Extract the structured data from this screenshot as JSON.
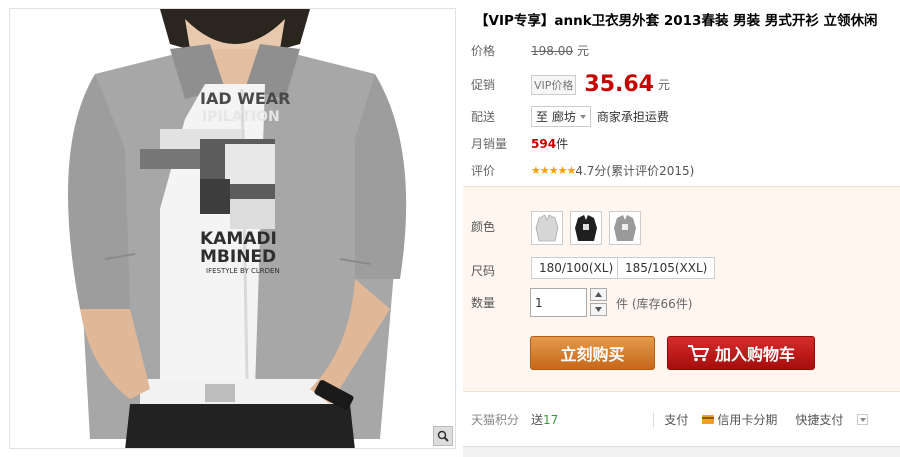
{
  "product": {
    "title": "【VIP专享】annk卫衣男外套 2013春装 男装 男式开衫 立领休闲",
    "print_lines": [
      "IAD WEAR",
      "IPILATION",
      "KAMADI",
      "MBINED",
      "IFESTYLE BY CLRDEN"
    ]
  },
  "price": {
    "label": "价格",
    "original": "198.00",
    "unit": "元"
  },
  "promo": {
    "label": "促销",
    "vip_tag": "VIP价格",
    "price": "35.64",
    "unit": "元"
  },
  "shipping": {
    "label": "配送",
    "destination": "至 廊坊",
    "note": "商家承担运费"
  },
  "sales": {
    "label": "月销量",
    "count": "594",
    "unit": "件"
  },
  "rating": {
    "label": "评价",
    "stars": "★★★★★",
    "text": "4.7分(累计评价2015)"
  },
  "options": {
    "color_label": "颜色",
    "size_label": "尺码",
    "sizes": [
      "180/100(XL)",
      "185/105(XXL)"
    ],
    "quantity_label": "数量",
    "quantity_value": "1",
    "stock_text": "件 (库存66件)"
  },
  "buttons": {
    "buy_now": "立刻购买",
    "add_to_cart": "加入购物车"
  },
  "bottom": {
    "points_label": "天猫积分",
    "points_value": "17",
    "points_prefix": "送",
    "pay_label": "支付",
    "credit_card": "信用卡分期",
    "quick_pay": "快捷支付"
  },
  "colors": {
    "price_red": "#c40000",
    "buy_orange": "#d27a2a",
    "cart_red": "#c01a1a",
    "options_bg": "#fff7ef"
  }
}
